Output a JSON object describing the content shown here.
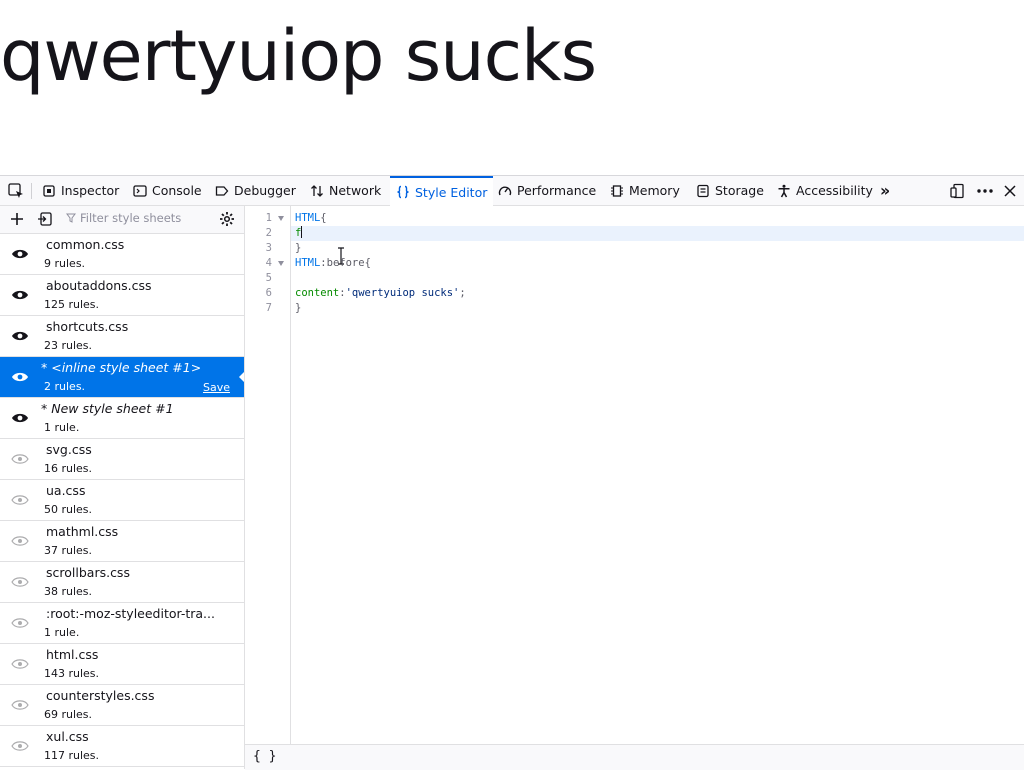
{
  "page": {
    "heading": "qwertyuiop sucks"
  },
  "toolbar": {
    "tabs": [
      {
        "label": "Inspector",
        "icon": "inspector-icon"
      },
      {
        "label": "Console",
        "icon": "console-icon"
      },
      {
        "label": "Debugger",
        "icon": "debugger-icon"
      },
      {
        "label": "Network",
        "icon": "network-icon"
      },
      {
        "label": "Style Editor",
        "icon": "style-editor-icon",
        "selected": true
      },
      {
        "label": "Performance",
        "icon": "performance-icon"
      },
      {
        "label": "Memory",
        "icon": "memory-icon"
      },
      {
        "label": "Storage",
        "icon": "storage-icon"
      },
      {
        "label": "Accessibility",
        "icon": "accessibility-icon"
      }
    ],
    "accent_color": "#0061e0"
  },
  "sidebar": {
    "filter_placeholder": "Filter style sheets",
    "sheets": [
      {
        "name": "common.css",
        "rules": "9 rules.",
        "enabled": true
      },
      {
        "name": "aboutaddons.css",
        "rules": "125 rules.",
        "enabled": true
      },
      {
        "name": "shortcuts.css",
        "rules": "23 rules.",
        "enabled": true
      },
      {
        "name": "* <inline style sheet #1>",
        "rules": "2 rules.",
        "enabled": true,
        "selected": true,
        "save_label": "Save"
      },
      {
        "name": "* New style sheet #1",
        "rules": "1 rule.",
        "enabled": true
      },
      {
        "name": "svg.css",
        "rules": "16 rules.",
        "enabled": false
      },
      {
        "name": "ua.css",
        "rules": "50 rules.",
        "enabled": false
      },
      {
        "name": "mathml.css",
        "rules": "37 rules.",
        "enabled": false
      },
      {
        "name": "scrollbars.css",
        "rules": "38 rules.",
        "enabled": false
      },
      {
        "name": ":root:-moz-styleeditor-tra...",
        "rules": "1 rule.",
        "enabled": false
      },
      {
        "name": "html.css",
        "rules": "143 rules.",
        "enabled": false
      },
      {
        "name": "counterstyles.css",
        "rules": "69 rules.",
        "enabled": false
      },
      {
        "name": "xul.css",
        "rules": "117 rules.",
        "enabled": false
      }
    ]
  },
  "editor": {
    "line_numbers": [
      "1",
      "2",
      "3",
      "4",
      "5",
      "6",
      "7"
    ],
    "lines": {
      "l1_sel": "HTML",
      "l1_punc": "{",
      "l2_text": "f",
      "l3_punc": "}",
      "l4_sel": "HTML",
      "l4_pseudo": ":before",
      "l4_punc": "{",
      "l6_prop": "content",
      "l6_colon": ":",
      "l6_str": "'qwertyuiop sucks'",
      "l6_semi": ";",
      "l7_punc": "}"
    },
    "footer_label": "{ }"
  }
}
